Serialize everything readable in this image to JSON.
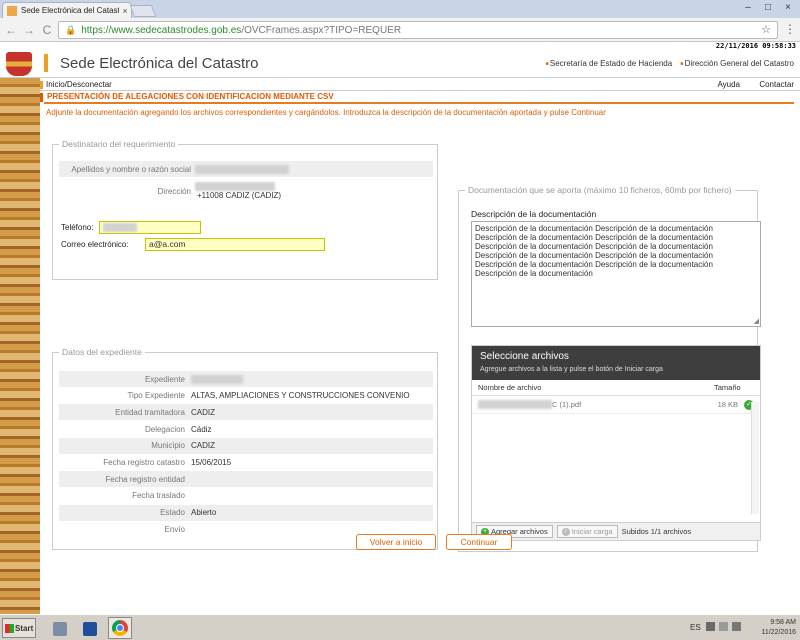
{
  "browser": {
    "tab_title": "Sede Electrónica del Catastr",
    "tab_close": "×",
    "url_host": "https://www.sedecatastrodes.gob.es",
    "url_path": "/OVCFrames.aspx?TIPO=REQUER",
    "back": "←",
    "forward": "→",
    "reload": "C",
    "star": "☆",
    "menu": "⋮",
    "min": "–",
    "max": "□",
    "close": "×"
  },
  "site": {
    "datetime": "22/11/2016 09:58:33",
    "title": "Sede Electrónica del Catastro",
    "links": [
      "Secretaría de Estado de Hacienda",
      "Dirección General del Catastro"
    ],
    "nav_inicio": "Inicio/Desconectar",
    "nav_ayuda": "Ayuda",
    "nav_contactar": "Contactar"
  },
  "heading": "PRESENTACIÓN DE ALEGACIONES CON IDENTIFICACION MEDIANTE CSV",
  "instructions": "Adjunte la documentación agregando los archivos correspondientes y cargándolos. Introduzca la descripción de la documentación aportada y pulse Continuar",
  "destinatario": {
    "legend": "Destinatario del requerimiento",
    "name_label": "Apellidos y nombre o razón social",
    "address_label": "Dirección",
    "address_value": "+11008 CADIZ (CADIZ)",
    "phone_label": "Teléfono:",
    "email_label": "Correo electrónico:",
    "email_value": "a@a.com"
  },
  "expediente": {
    "legend": "Datos del expediente",
    "rows": [
      {
        "label": "Expediente",
        "value": ""
      },
      {
        "label": "Tipo Expediente",
        "value": "ALTAS, AMPLIACIONES Y CONSTRUCCIONES CONVENIO"
      },
      {
        "label": "Entidad tramitadora",
        "value": "CADIZ"
      },
      {
        "label": "Delegacion",
        "value": "Cádiz"
      },
      {
        "label": "Municipio",
        "value": "CADIZ"
      },
      {
        "label": "Fecha registro catastro",
        "value": "15/06/2015"
      },
      {
        "label": "Fecha registro entidad",
        "value": ""
      },
      {
        "label": "Fecha traslado",
        "value": ""
      },
      {
        "label": "Estado",
        "value": "Abierto"
      },
      {
        "label": "Envío",
        "value": ""
      }
    ]
  },
  "documentacion": {
    "legend": "Documentación que se aporta (máximo 10 ficheros, 60mb por fichero)",
    "desc_label": "Descripción de la documentación",
    "desc_text": "Descripción de la documentación Descripción de la documentación\nDescripción de la documentación Descripción de la documentación\nDescripción de la documentación Descripción de la documentación\nDescripción de la documentación  Descripción de la documentación\nDescripción de la documentación Descripción de la documentación\nDescripción de la documentación"
  },
  "uploader": {
    "title": "Seleccione archivos",
    "subtitle": "Agregue archivos a la lista y pulse el botón de Iniciar carga",
    "col_name": "Nombre de archivo",
    "col_size": "Tamaño",
    "file_name": "C (1).pdf",
    "file_size": "18 KB",
    "add_btn": "Agregar archivos",
    "start_btn": "Iniciar carga",
    "status": "Subidos 1/1 archivos"
  },
  "buttons": {
    "volver": "Volver a inicio",
    "continuar": "Continuar"
  },
  "taskbar": {
    "start": "Start",
    "lang": "ES",
    "time": "9:58 AM",
    "date": "11/22/2016"
  }
}
